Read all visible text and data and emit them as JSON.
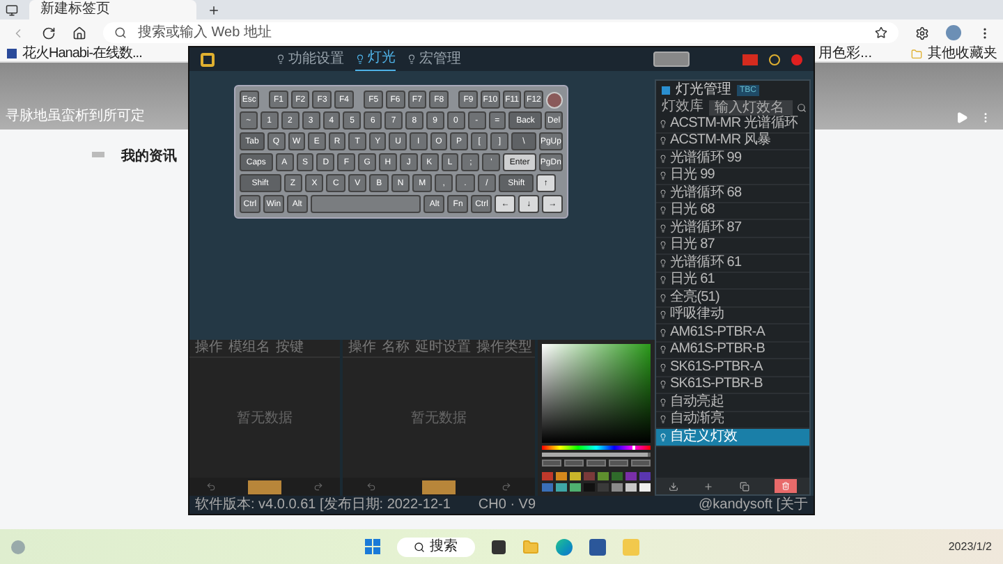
{
  "browser": {
    "tab": {
      "title": "新建标签页"
    },
    "address": {
      "placeholder": "搜索或输入 Web 地址"
    },
    "bookmarks": [
      {
        "label": "花火Hanabi-在线数..."
      }
    ],
    "other_bookmarks": "其他收藏夹",
    "hidden_bookmark": "用色彩..."
  },
  "page": {
    "banner_text": "寻脉地虽蛮析到所可定",
    "section_title": "我的资讯"
  },
  "app": {
    "nav": [
      {
        "label": "功能设置",
        "selected": false
      },
      {
        "label": "灯光",
        "selected": true
      },
      {
        "label": "宏管理",
        "selected": false
      }
    ],
    "keyboard": [
      [
        {
          "label": "Esc",
          "kind": "std"
        },
        {
          "kind": "gap"
        },
        {
          "label": "F1",
          "kind": "std"
        },
        {
          "label": "F2",
          "kind": "std"
        },
        {
          "label": "F3",
          "kind": "std"
        },
        {
          "label": "F4",
          "kind": "std"
        },
        {
          "kind": "gap"
        },
        {
          "label": "F5",
          "kind": "std"
        },
        {
          "label": "F6",
          "kind": "std"
        },
        {
          "label": "F7",
          "kind": "std"
        },
        {
          "label": "F8",
          "kind": "std"
        },
        {
          "kind": "gap"
        },
        {
          "label": "F9",
          "kind": "std"
        },
        {
          "label": "F10",
          "kind": "std"
        },
        {
          "label": "F11",
          "kind": "std"
        },
        {
          "label": "F12",
          "kind": "std"
        },
        {
          "kind": "knob"
        }
      ],
      [
        {
          "label": "~",
          "kind": "std"
        },
        {
          "label": "1",
          "kind": "std"
        },
        {
          "label": "2",
          "kind": "std"
        },
        {
          "label": "3",
          "kind": "std"
        },
        {
          "label": "4",
          "kind": "std"
        },
        {
          "label": "5",
          "kind": "std"
        },
        {
          "label": "6",
          "kind": "std"
        },
        {
          "label": "7",
          "kind": "std"
        },
        {
          "label": "8",
          "kind": "std"
        },
        {
          "label": "9",
          "kind": "std"
        },
        {
          "label": "0",
          "kind": "std"
        },
        {
          "label": "-",
          "kind": "std"
        },
        {
          "label": "=",
          "kind": "std"
        },
        {
          "label": "Back",
          "kind": "long"
        },
        {
          "label": "Del",
          "kind": "std"
        }
      ],
      [
        {
          "label": "Tab",
          "kind": "mod"
        },
        {
          "label": "Q",
          "kind": "std"
        },
        {
          "label": "W",
          "kind": "std"
        },
        {
          "label": "E",
          "kind": "std"
        },
        {
          "label": "R",
          "kind": "std"
        },
        {
          "label": "T",
          "kind": "std"
        },
        {
          "label": "Y",
          "kind": "std"
        },
        {
          "label": "U",
          "kind": "std"
        },
        {
          "label": "I",
          "kind": "std"
        },
        {
          "label": "O",
          "kind": "std"
        },
        {
          "label": "P",
          "kind": "std"
        },
        {
          "label": "[",
          "kind": "std"
        },
        {
          "label": "]",
          "kind": "std"
        },
        {
          "label": "\\",
          "kind": "mod"
        },
        {
          "label": "PgUp",
          "kind": "std"
        }
      ],
      [
        {
          "label": "Caps",
          "kind": "long"
        },
        {
          "label": "A",
          "kind": "std"
        },
        {
          "label": "S",
          "kind": "std"
        },
        {
          "label": "D",
          "kind": "std"
        },
        {
          "label": "F",
          "kind": "std"
        },
        {
          "label": "G",
          "kind": "std"
        },
        {
          "label": "H",
          "kind": "std"
        },
        {
          "label": "J",
          "kind": "std"
        },
        {
          "label": "K",
          "kind": "std"
        },
        {
          "label": "L",
          "kind": "std"
        },
        {
          "label": ";",
          "kind": "std"
        },
        {
          "label": "'",
          "kind": "std"
        },
        {
          "label": "Enter",
          "kind": "accent"
        },
        {
          "label": "PgDn",
          "kind": "std"
        }
      ],
      [
        {
          "label": "Shift",
          "kind": "wide"
        },
        {
          "label": "Z",
          "kind": "std"
        },
        {
          "label": "X",
          "kind": "std"
        },
        {
          "label": "C",
          "kind": "std"
        },
        {
          "label": "V",
          "kind": "std"
        },
        {
          "label": "B",
          "kind": "std"
        },
        {
          "label": "N",
          "kind": "std"
        },
        {
          "label": "M",
          "kind": "std"
        },
        {
          "label": ",",
          "kind": "std"
        },
        {
          "label": ".",
          "kind": "std"
        },
        {
          "label": "/",
          "kind": "std"
        },
        {
          "label": "Shift",
          "kind": "long"
        },
        {
          "label": "↑",
          "kind": "light"
        },
        {
          "kind": "gap"
        }
      ],
      [
        {
          "label": "Ctrl",
          "kind": "std"
        },
        {
          "label": "Win",
          "kind": "std"
        },
        {
          "label": "Alt",
          "kind": "std"
        },
        {
          "kind": "space"
        },
        {
          "label": "Alt",
          "kind": "std"
        },
        {
          "label": "Fn",
          "kind": "std"
        },
        {
          "label": "Ctrl",
          "kind": "std"
        },
        {
          "label": "←",
          "kind": "light"
        },
        {
          "label": "↓",
          "kind": "light"
        },
        {
          "label": "→",
          "kind": "light"
        }
      ]
    ],
    "panels": [
      {
        "columns": [
          "操作",
          "模组名",
          "按键"
        ],
        "empty": "暂无数据"
      },
      {
        "columns": [
          "操作",
          "名称",
          "延时设置",
          "操作类型"
        ],
        "empty": "暂无数据"
      }
    ],
    "picker": {
      "hue": {
        "level": 0.85
      },
      "alpha": {
        "level": 0.97
      }
    },
    "swatches": [
      {
        "color": "#c0392b"
      },
      {
        "color": "#d4881c"
      },
      {
        "color": "#c9b52a"
      },
      {
        "color": "#7a3a3a"
      },
      {
        "color": "#5f8f2e"
      },
      {
        "color": "#2f6b2a"
      },
      {
        "color": "#7a2fa8"
      },
      {
        "color": "#5a36b0"
      },
      {
        "color": "#3a6fb8"
      },
      {
        "color": "#3fa7a7"
      },
      {
        "color": "#4fb06f"
      },
      {
        "color": "#111111"
      },
      {
        "color": "#3a3a3a"
      },
      {
        "color": "#8a8a8a"
      },
      {
        "color": "#c8c8c8"
      },
      {
        "color": "#eeeeee"
      }
    ],
    "lighting": {
      "title": "灯光管理",
      "badge": "TBC",
      "checked": true,
      "library_tab": "灯效库",
      "search": {
        "placeholder": "输入灯效名"
      },
      "effects": [
        {
          "name": "ACSTM-MR 光谱循环",
          "selected": false
        },
        {
          "name": "ACSTM-MR 风暴",
          "selected": false
        },
        {
          "name": "光谱循环 99",
          "selected": false
        },
        {
          "name": "日光 99",
          "selected": false
        },
        {
          "name": "光谱循环 68",
          "selected": false
        },
        {
          "name": "日光 68",
          "selected": false
        },
        {
          "name": "光谱循环 87",
          "selected": false
        },
        {
          "name": "日光 87",
          "selected": false
        },
        {
          "name": "光谱循环 61",
          "selected": false
        },
        {
          "name": "日光 61",
          "selected": false
        },
        {
          "name": "全亮(51)",
          "selected": false
        },
        {
          "name": "呼吸律动",
          "selected": false
        },
        {
          "name": "AM61S-PTBR-A",
          "selected": false
        },
        {
          "name": "AM61S-PTBR-B",
          "selected": false
        },
        {
          "name": "SK61S-PTBR-A",
          "selected": false
        },
        {
          "name": "SK61S-PTBR-B",
          "selected": false
        },
        {
          "name": "自动亮起",
          "selected": false
        },
        {
          "name": "自动渐亮",
          "selected": false
        },
        {
          "name": "自定义灯效",
          "selected": true
        }
      ]
    },
    "status": {
      "version": "软件版本: v4.0.0.61 [发布日期: 2022-12-1",
      "channel": "CH0 · V9",
      "user": "@kandysoft [关于"
    }
  },
  "taskbar": {
    "search": "搜索",
    "date": "2023/1/2"
  }
}
